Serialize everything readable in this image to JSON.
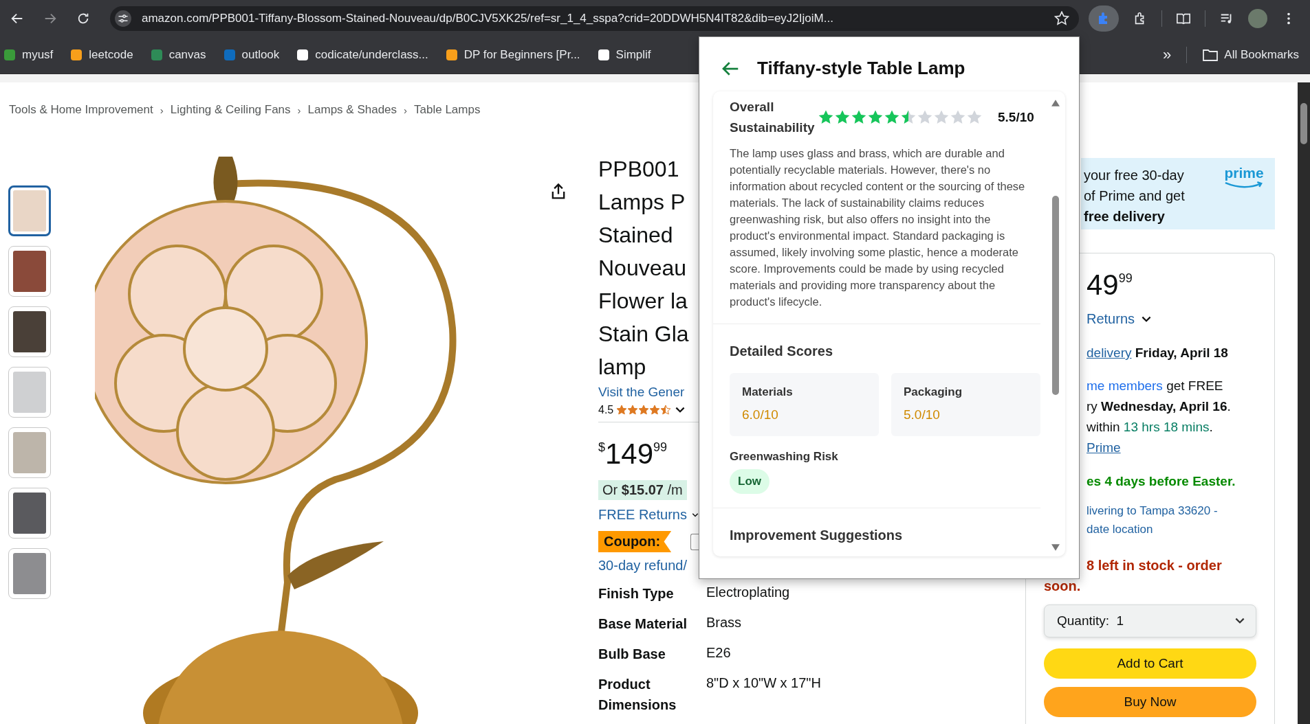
{
  "browser": {
    "url": "amazon.com/PPB001-Tiffany-Blossom-Stained-Nouveau/dp/B0CJV5XK25/ref=sr_1_4_sspa?crid=20DDWH5N4IT82&dib=eyJ2IjoiM...",
    "bookmarks": [
      {
        "label": "myusf",
        "color": "#3a9b3a"
      },
      {
        "label": "leetcode",
        "color": "#f89f1b"
      },
      {
        "label": "canvas",
        "color": "#2e8b57"
      },
      {
        "label": "outlook",
        "color": "#0f6cbd"
      },
      {
        "label": "codicate/underclass...",
        "color": "#ffffff"
      },
      {
        "label": "DP for Beginners [Pr...",
        "color": "#f89f1b"
      },
      {
        "label": "Simplif",
        "color": "#ffffff"
      }
    ],
    "overflow": "»",
    "all_bookmarks": "All Bookmarks"
  },
  "breadcrumb": {
    "separator": "›",
    "items": [
      "Tools & Home Improvement",
      "Lighting & Ceiling Fans",
      "Lamps & Shades",
      "Table Lamps"
    ]
  },
  "thumbnails": [
    {
      "selected": true
    },
    {
      "selected": false
    },
    {
      "selected": false
    },
    {
      "selected": false
    },
    {
      "selected": false
    },
    {
      "selected": false
    },
    {
      "selected": false
    }
  ],
  "product": {
    "title_lines": [
      "PPB001",
      "Lamps P",
      "Stained",
      "Nouveau",
      "Flower la",
      "Stain Gla",
      "lamp"
    ],
    "store_link": "Visit the Gener",
    "rating": "4.5",
    "stars": 4.5,
    "price": {
      "symbol": "$",
      "whole": "149",
      "fraction": "99"
    },
    "installment": "Or **$15.07** /m",
    "returns": "FREE Returns",
    "coupon": "Coupon:",
    "coupon_checked": false,
    "refund": "30-day refund/",
    "specs": [
      {
        "label": "Finish Type",
        "value": "Electroplating"
      },
      {
        "label": "Base Material",
        "value": "Brass"
      },
      {
        "label": "Bulb Base",
        "value": "E26"
      },
      {
        "label": "Product Dimensions",
        "value": "8\"D x 10\"W x 17\"H"
      }
    ]
  },
  "buy_box": {
    "prime_banner": {
      "lines": [
        {
          "text": "your free 30-day",
          "bold": false
        },
        {
          "text": "of Prime and get",
          "bold": false
        },
        {
          "text": "free delivery",
          "bold": true
        }
      ],
      "logo": "prime"
    },
    "price_whole": "49",
    "price_fraction": "99",
    "returns": "Returns",
    "delivery_lines": [
      [
        {
          "kind": "link",
          "text": "delivery"
        },
        {
          "kind": "bold",
          "text": "Friday, April 18"
        }
      ],
      [
        {
          "kind": "blue",
          "text": "me members"
        },
        {
          "kind": "plain",
          "text": "get FREE"
        }
      ],
      [
        {
          "kind": "plain",
          "text": "ry"
        },
        {
          "kind": "bold",
          "text": "Wednesday, April 16"
        },
        {
          "kind": "plain",
          "text": ".",
          "attached": true
        }
      ],
      [
        {
          "kind": "plain",
          "text": "within"
        },
        {
          "kind": "green",
          "text": "13 hrs 18 mins"
        },
        {
          "kind": "plain",
          "text": ".",
          "attached": true
        }
      ],
      [
        {
          "kind": "link",
          "text": "Prime"
        }
      ]
    ],
    "holiday_note": "es 4 days before Easter.",
    "location_lines": [
      "livering to Tampa 33620 -",
      "date location"
    ],
    "stock_lines": [
      "8 left in stock - order",
      "soon."
    ],
    "quantity": {
      "label": "Quantity:",
      "value": "1"
    },
    "buttons": [
      {
        "label": "Add to Cart",
        "kind": "cart"
      },
      {
        "label": "Buy Now",
        "kind": "buy"
      }
    ]
  },
  "popup": {
    "title": "Tiffany-style Table Lamp",
    "overall": {
      "label": "Overall Sustainability",
      "stars": 5.5,
      "score": "5.5/10",
      "summary": "The lamp uses glass and brass, which are durable and potentially recyclable materials. However, there's no information about recycled content or the sourcing of these materials. The lack of sustainability claims reduces greenwashing risk, but also offers no insight into the product's environmental impact. Standard packaging is assumed, likely involving some plastic, hence a moderate score. Improvements could be made by using recycled materials and providing more transparency about the product's lifecycle."
    },
    "detailed_title": "Detailed Scores",
    "scores": [
      {
        "label": "Materials",
        "value": "6.0/10"
      },
      {
        "label": "Packaging",
        "value": "5.0/10"
      }
    ],
    "greenwashing": {
      "label": "Greenwashing Risk",
      "value": "Low",
      "kind": "low"
    },
    "next_section": "Improvement Suggestions"
  }
}
